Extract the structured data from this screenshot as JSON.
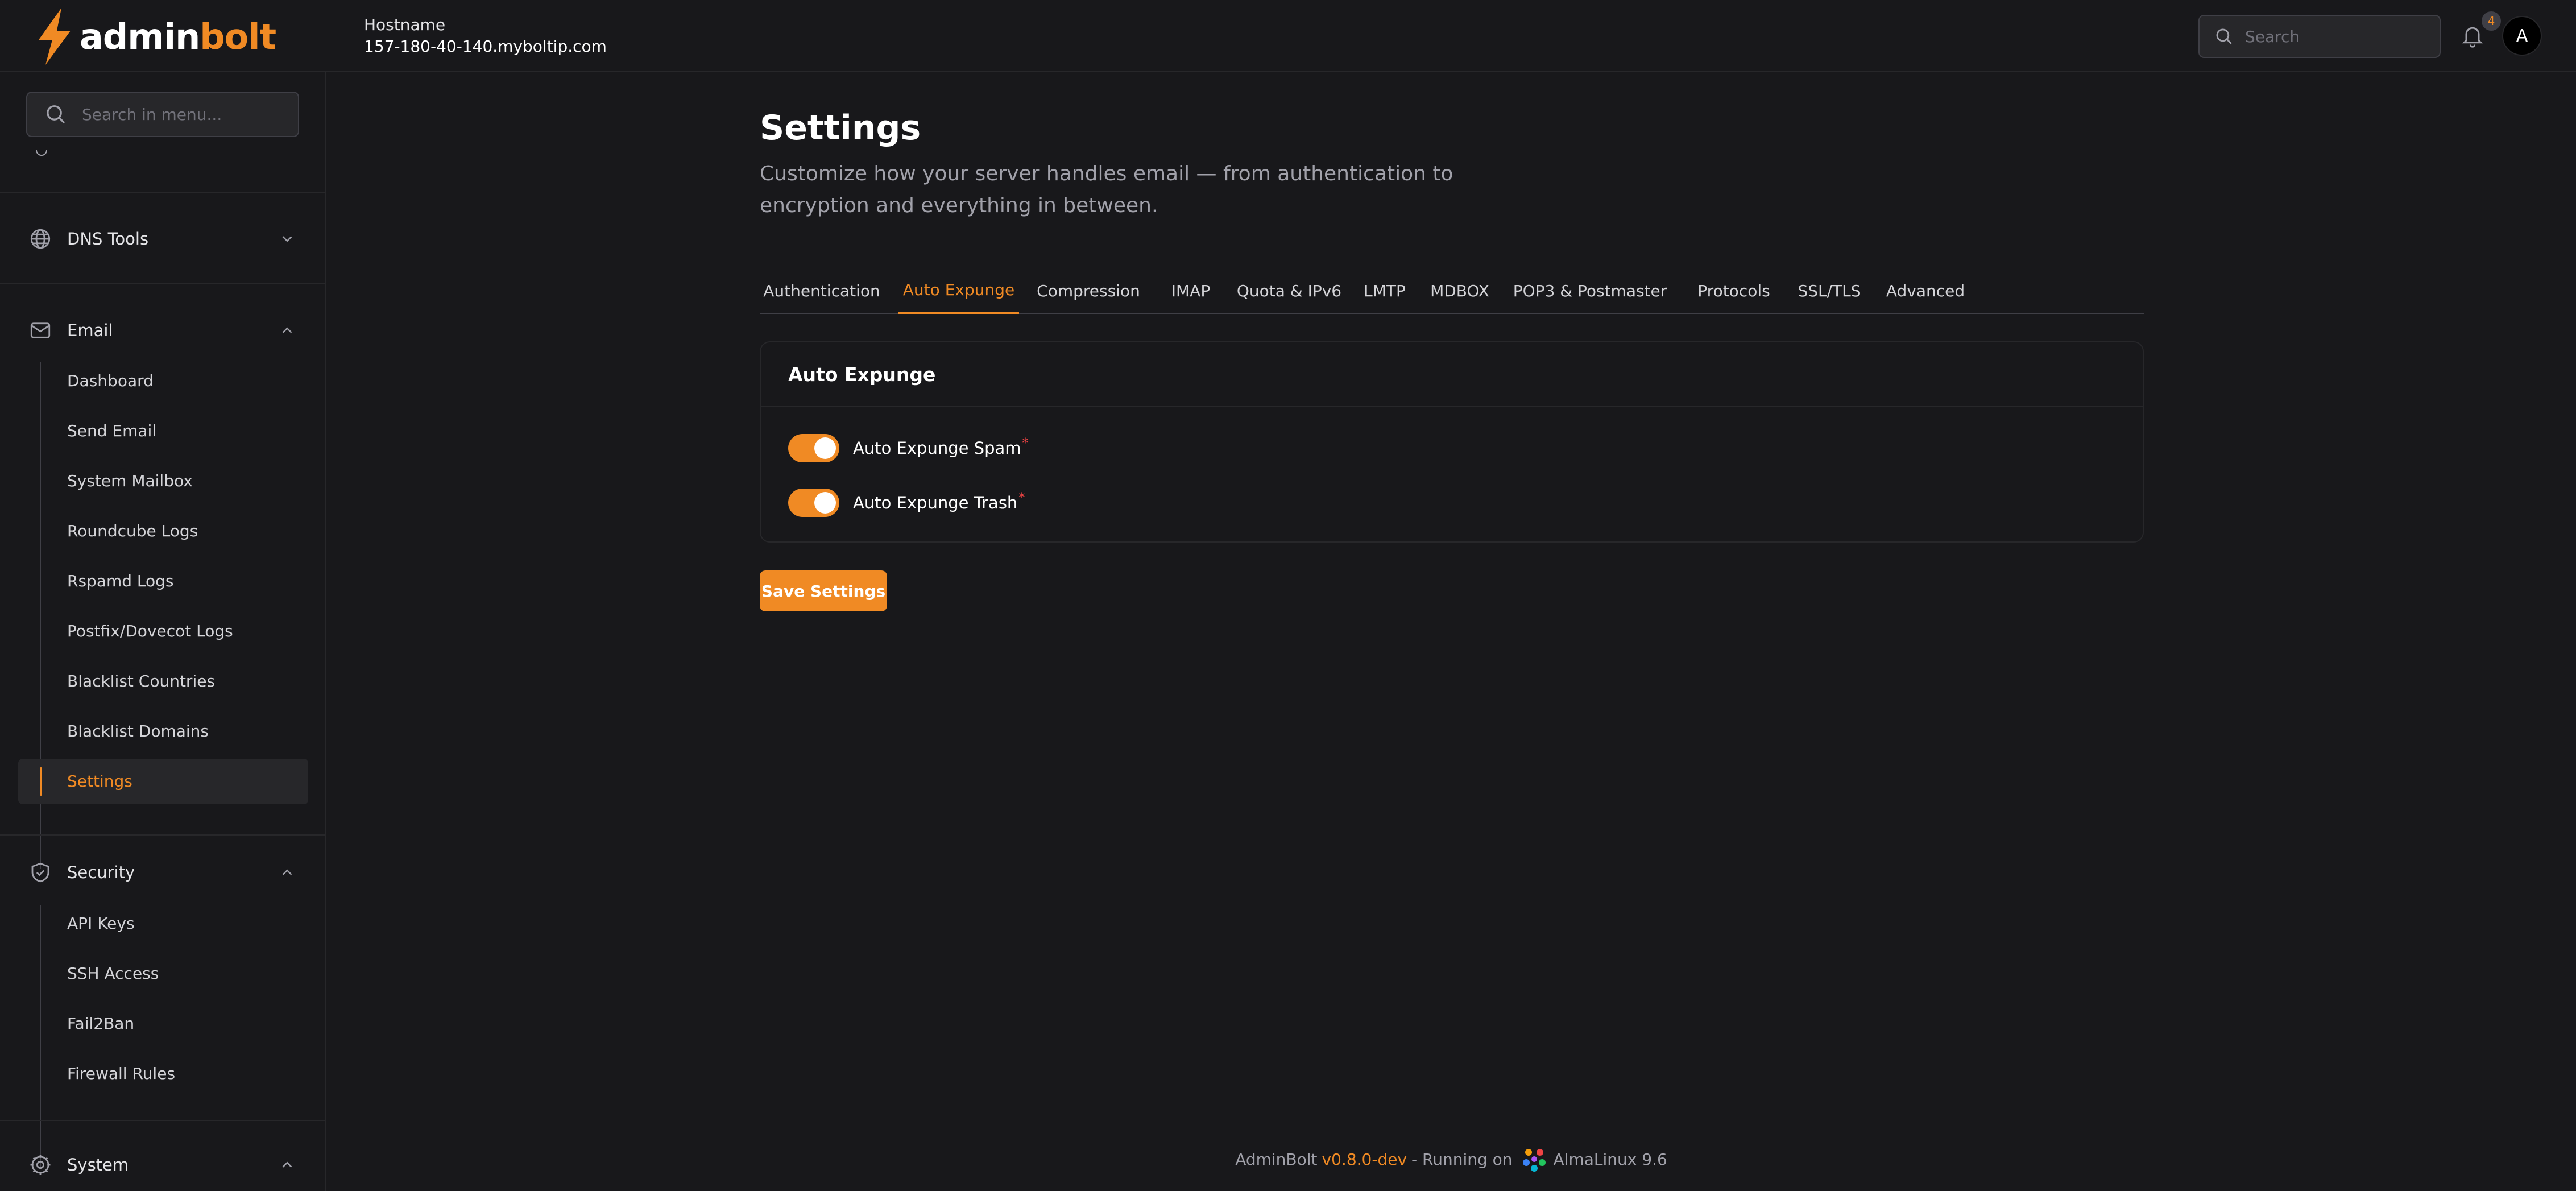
{
  "brand": {
    "name_part1": "admin",
    "name_part2": "bolt",
    "accent": "#f08a24"
  },
  "header": {
    "hostname_label": "Hostname",
    "hostname_value": "157-180-40-140.myboltip.com",
    "search_placeholder": "Search",
    "notification_count": "4",
    "avatar_initial": "A"
  },
  "sidebar": {
    "search_placeholder": "Search in menu...",
    "groups": [
      {
        "label": "DNS Tools",
        "icon": "globe-icon",
        "expanded": false
      },
      {
        "label": "Email",
        "icon": "mail-icon",
        "expanded": true,
        "items": [
          "Dashboard",
          "Send Email",
          "System Mailbox",
          "Roundcube Logs",
          "Rspamd Logs",
          "Postfix/Dovecot Logs",
          "Blacklist Countries",
          "Blacklist Domains",
          "Settings"
        ],
        "active_item": "Settings"
      },
      {
        "label": "Security",
        "icon": "shield-icon",
        "expanded": true,
        "items": [
          "API Keys",
          "SSH Access",
          "Fail2Ban",
          "Firewall Rules"
        ]
      },
      {
        "label": "System",
        "icon": "gear-icon",
        "expanded": true
      }
    ]
  },
  "main": {
    "title": "Settings",
    "subtitle": "Customize how your server handles email — from authentication to encryption and everything in between.",
    "tabs": [
      "Authentication",
      "Auto Expunge",
      "Compression",
      "IMAP",
      "Quota & IPv6",
      "LMTP",
      "MDBOX",
      "POP3 & Postmaster",
      "Protocols",
      "SSL/TLS",
      "Advanced"
    ],
    "active_tab": "Auto Expunge",
    "card": {
      "title": "Auto Expunge",
      "toggles": [
        {
          "label": "Auto Expunge Spam",
          "required_mark": "*",
          "on": true
        },
        {
          "label": "Auto Expunge Trash",
          "required_mark": "*",
          "on": true
        }
      ]
    },
    "save_label": "Save Settings"
  },
  "footer": {
    "app_name": "AdminBolt",
    "version": "v0.8.0-dev",
    "running_on": "- Running on",
    "os": "AlmaLinux 9.6"
  }
}
